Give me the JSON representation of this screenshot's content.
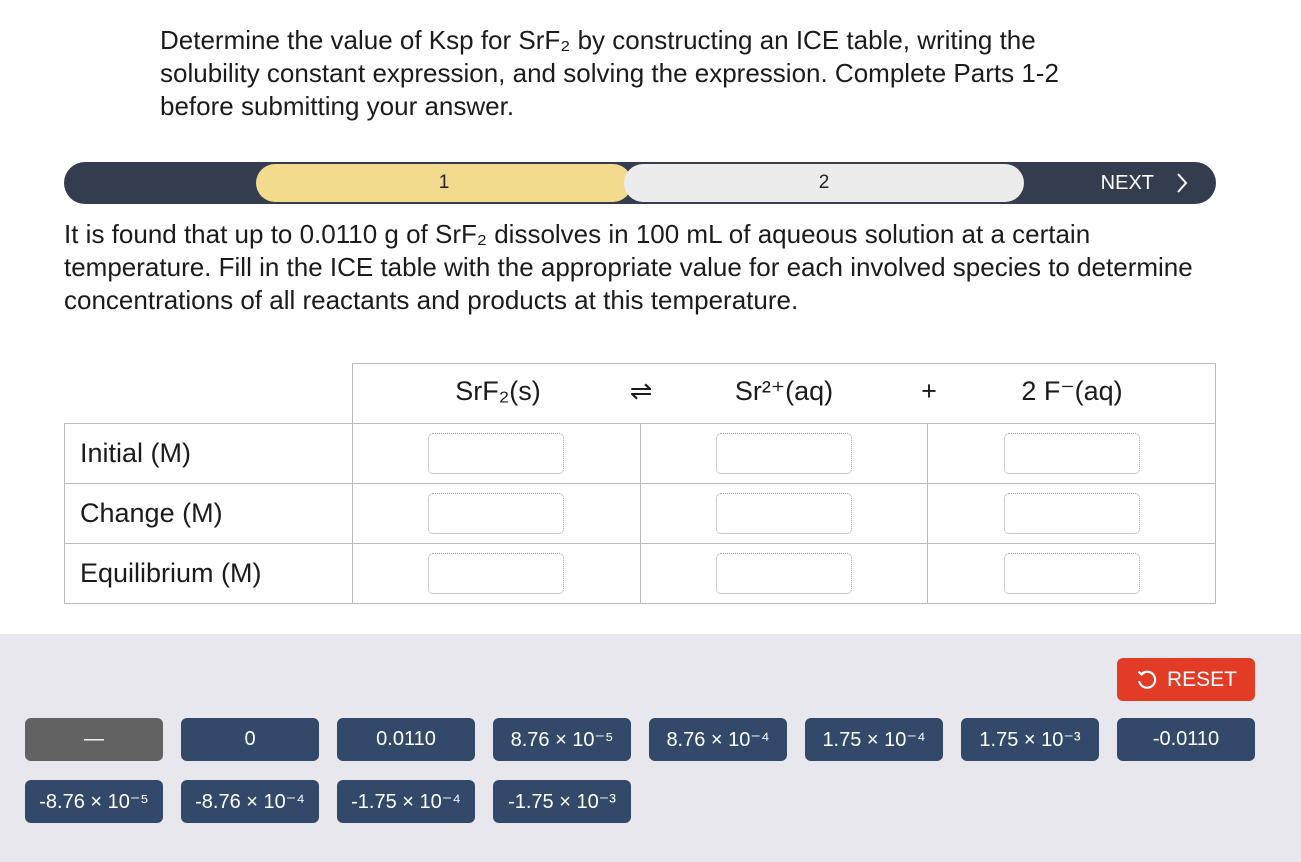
{
  "instructions": "Determine the value of Ksp for SrF₂ by constructing an ICE table, writing the solubility constant expression, and solving the expression. Complete Parts 1-2 before submitting your answer.",
  "progress": {
    "steps": [
      "1",
      "2"
    ],
    "next_label": "NEXT",
    "colors": {
      "bar": "#333d4f",
      "active_step": "#f3db8e",
      "inactive_step": "#ececec"
    }
  },
  "description": "It is found that up to 0.0110 g of SrF₂ dissolves in 100 mL of aqueous solution at a certain temperature. Fill in the ICE table with the appropriate value for each involved species to determine concentrations of all reactants and products at this temperature.",
  "ice_table": {
    "header": {
      "reactant": "SrF₂(s)",
      "arrow": "⇌",
      "product1": "Sr²⁺(aq)",
      "plus": "+",
      "product2": "2 F⁻(aq)"
    },
    "rows": [
      "Initial (M)",
      "Change (M)",
      "Equilibrium (M)"
    ]
  },
  "answer_bank": {
    "reset_label": "RESET",
    "tiles": [
      "—",
      "0",
      "0.0110",
      "8.76 × 10⁻⁵",
      "8.76 × 10⁻⁴",
      "1.75 × 10⁻⁴",
      "1.75 × 10⁻³",
      "-0.0110",
      "-8.76 × 10⁻⁵",
      "-8.76 × 10⁻⁴",
      "-1.75 × 10⁻⁴",
      "-1.75 × 10⁻³"
    ],
    "colors": {
      "tile": "#33496a",
      "dash_tile": "#626262",
      "reset": "#e23b26",
      "panel": "#e8e7ee"
    }
  }
}
